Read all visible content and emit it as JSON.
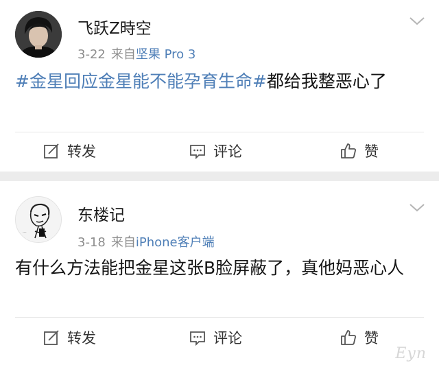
{
  "posts": [
    {
      "username": "飞跃Z時空",
      "date": "3-22",
      "source_prefix": "来自",
      "source_name": "坚果 Pro 3",
      "hashtag": "#金星回应金星能不能孕育生命#",
      "text": "都给我整恶心了",
      "actions": {
        "repost": "转发",
        "comment": "评论",
        "like": "赞"
      }
    },
    {
      "username": "东楼记",
      "date": "3-18",
      "source_prefix": "来自",
      "source_name": "iPhone客户端",
      "text": "有什么方法能把金星这张B脸屏蔽了，真他妈恶心人",
      "actions": {
        "repost": "转发",
        "comment": "评论",
        "like": "赞"
      }
    }
  ],
  "icons": {
    "avatar_1": "man-portrait-avatar",
    "avatar_2": "sketch-caricature-avatar",
    "menu": "chevron-down-icon",
    "repost": "edit-repost-icon",
    "comment": "comment-bubble-icon",
    "like": "thumbs-up-icon"
  },
  "colors": {
    "link": "#4f7fb7",
    "meta": "#8d8d8d",
    "background": "#ececec",
    "card": "#ffffff"
  }
}
